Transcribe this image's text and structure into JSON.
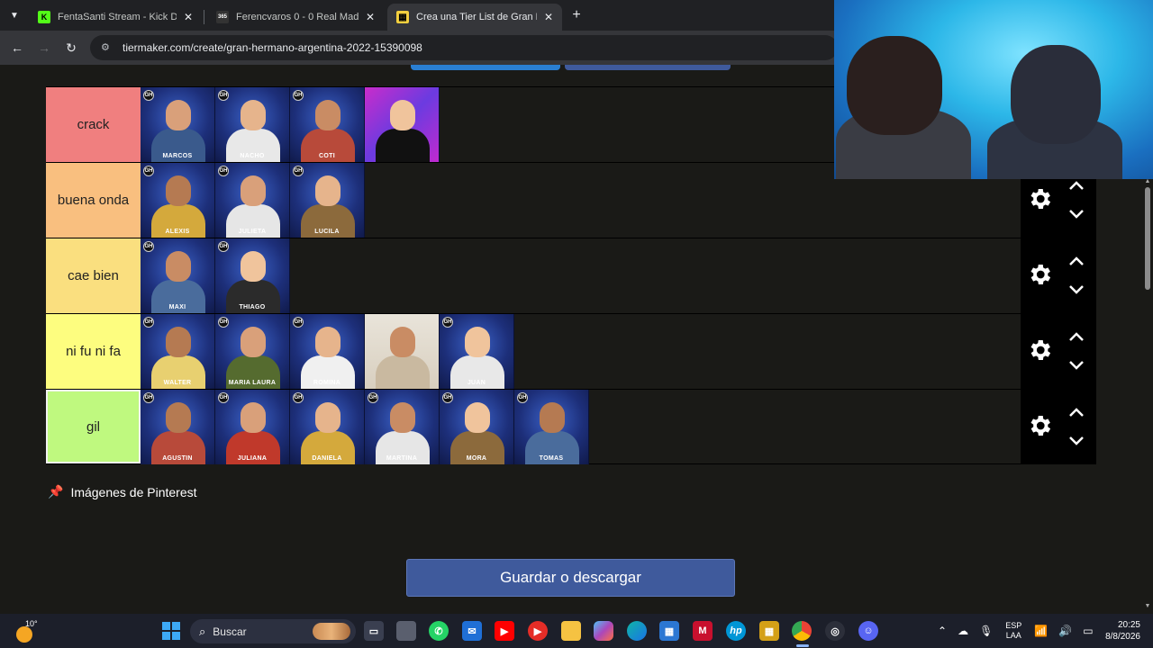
{
  "browser": {
    "tabs": [
      {
        "title": "FentaSanti Stream - Kick Dashb",
        "favicon": "kick-icon",
        "color": "#53fc18",
        "glyph": "K"
      },
      {
        "title": "Ferencvaros 0 - 0 Real Madrid (",
        "favicon": "365-icon",
        "color": "#222222",
        "glyph": "365"
      },
      {
        "title": "Crea una Tier List de Gran Herm",
        "favicon": "tiermaker-icon",
        "color": "#f4d03f",
        "glyph": "▦"
      }
    ],
    "url": "tiermaker.com/create/gran-hermano-argentina-2022-15390098"
  },
  "tiers": [
    {
      "label": "crack",
      "color": "#f07f7f",
      "items": [
        "MARCOS",
        "NACHO",
        "COTI",
        ""
      ]
    },
    {
      "label": "buena onda",
      "color": "#f9bf7f",
      "items": [
        "ALEXIS",
        "JULIETA",
        "LUCILA"
      ]
    },
    {
      "label": "cae bien",
      "color": "#fadf7f",
      "items": [
        "MAXI",
        "THIAGO"
      ]
    },
    {
      "label": "ni fu ni fa",
      "color": "#fdfd7f",
      "items": [
        "WALTER",
        "MARIA LAURA",
        "ROMINA",
        "",
        "JUAN"
      ]
    },
    {
      "label": "gil",
      "color": "#bff97f",
      "items": [
        "AGUSTIN",
        "JULIANA",
        "DANIELA",
        "MARTINA",
        "MORA",
        "TOMAS"
      ]
    }
  ],
  "badge_text": "GH",
  "pinterest_label": "Imágenes de Pinterest",
  "save_button": "Guardar o descargar",
  "taskbar": {
    "temperature": "10°",
    "search_label": "Buscar",
    "language": "ESP",
    "keyboard": "LAA",
    "time": "20:25",
    "date": "8/8/2026"
  }
}
